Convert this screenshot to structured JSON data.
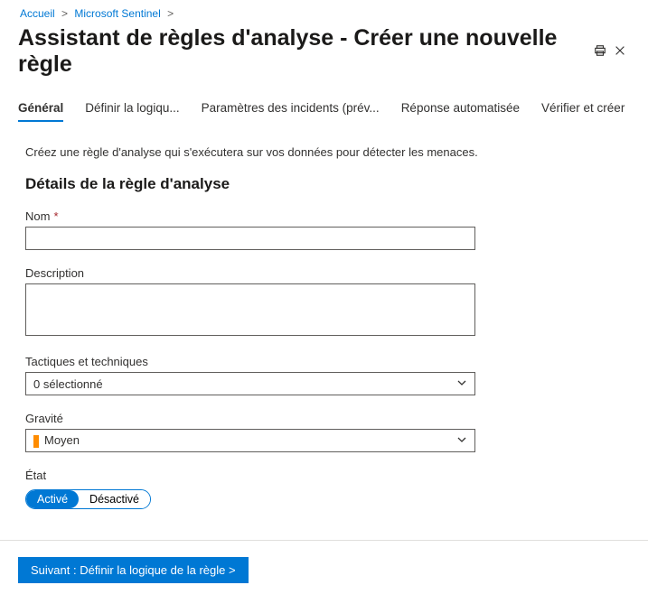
{
  "breadcrumb": {
    "home": "Accueil",
    "sentinel": "Microsoft Sentinel"
  },
  "header": {
    "title": "Assistant de règles d'analyse - Créer une nouvelle règle"
  },
  "tabs": {
    "general": "Général",
    "logic": "Définir la logiqu...",
    "incidents": "Paramètres des incidents (prév...",
    "response": "Réponse automatisée",
    "review": "Vérifier et créer"
  },
  "intro": "Créez une règle d'analyse qui s'exécutera sur vos données pour détecter les menaces.",
  "section_title": "Détails de la règle d'analyse",
  "fields": {
    "name_label": "Nom",
    "name_value": "",
    "description_label": "Description",
    "description_value": "",
    "tactics_label": "Tactiques et techniques",
    "tactics_selected": "0 sélectionné",
    "severity_label": "Gravité",
    "severity_selected": "Moyen",
    "status_label": "État",
    "status_enabled": "Activé",
    "status_disabled": "Désactivé"
  },
  "footer": {
    "next_label": "Suivant : Définir la logique de la règle  >"
  }
}
